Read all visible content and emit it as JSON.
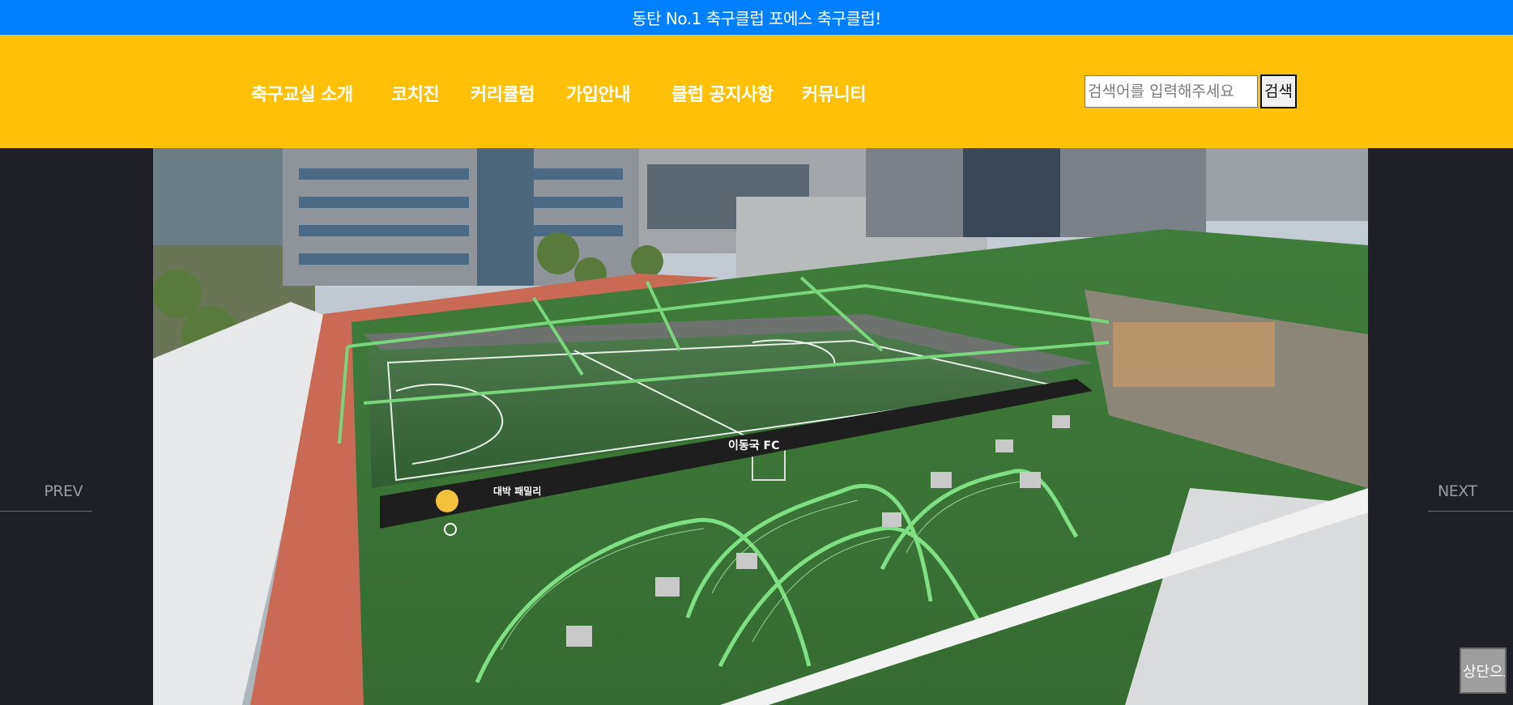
{
  "topbar": {
    "text": "동탄 No.1 축구클럽 포에스 축구클럽!"
  },
  "nav": {
    "items": [
      {
        "label": "축구교실 소개"
      },
      {
        "label": "코치진"
      },
      {
        "label": "커리큘럼"
      },
      {
        "label": "가입안내"
      },
      {
        "label": "클럽 공지사항"
      },
      {
        "label": "커뮤니티"
      }
    ]
  },
  "search": {
    "placeholder": "검색어를 입력해주세요",
    "button_label": "검색"
  },
  "slider": {
    "prev_label": "PREV",
    "next_label": "NEXT",
    "image_icon": "rooftop-futsal-court-photo"
  },
  "logo_text": {
    "team": "이동국 FC",
    "sponsor": "대박 패밀리"
  },
  "scroll_top": {
    "label": "상단으로"
  },
  "colors": {
    "topbar": "#0080ff",
    "header": "#ffc107",
    "background": "#1f1f27",
    "turf": "#3c7a3a",
    "arch": "#7ee081"
  }
}
